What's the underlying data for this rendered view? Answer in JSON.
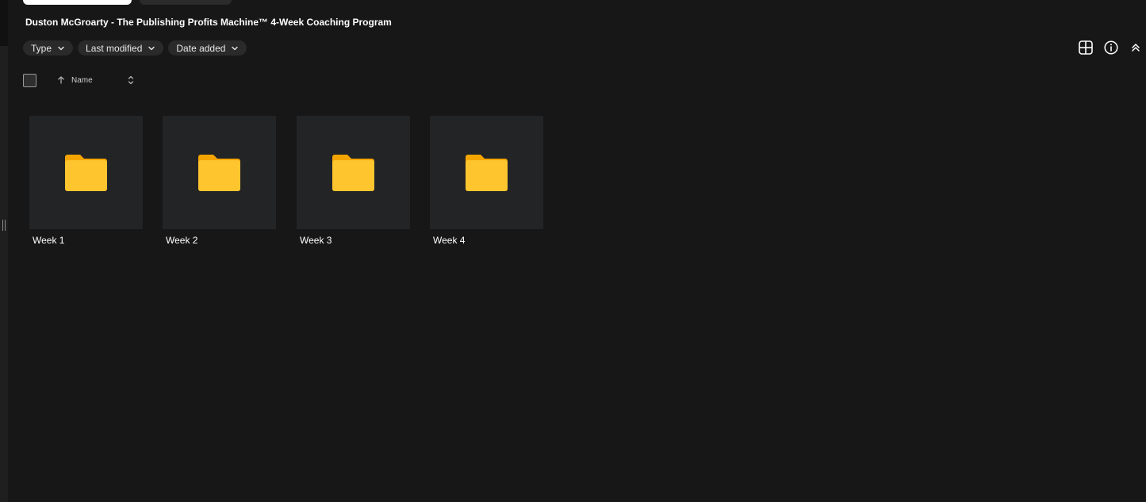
{
  "header": {
    "folder_title": "Duston McGroarty - The Publishing Profits Machine™ 4-Week Coaching Program"
  },
  "filters": [
    {
      "label": "Type"
    },
    {
      "label": "Last modified"
    },
    {
      "label": "Date added"
    }
  ],
  "columns": {
    "name_label": "Name"
  },
  "toolbar_icons": [
    "grid-view-icon",
    "info-icon",
    "collapse-up-icon"
  ],
  "items": [
    {
      "label": "Week 1",
      "type": "folder"
    },
    {
      "label": "Week 2",
      "type": "folder"
    },
    {
      "label": "Week 3",
      "type": "folder"
    },
    {
      "label": "Week 4",
      "type": "folder"
    }
  ],
  "colors": {
    "background": "#171717",
    "tile": "#232426",
    "folder_light": "#FFC52E",
    "folder_dark": "#F5A500",
    "chip": "#2A2A2A"
  }
}
